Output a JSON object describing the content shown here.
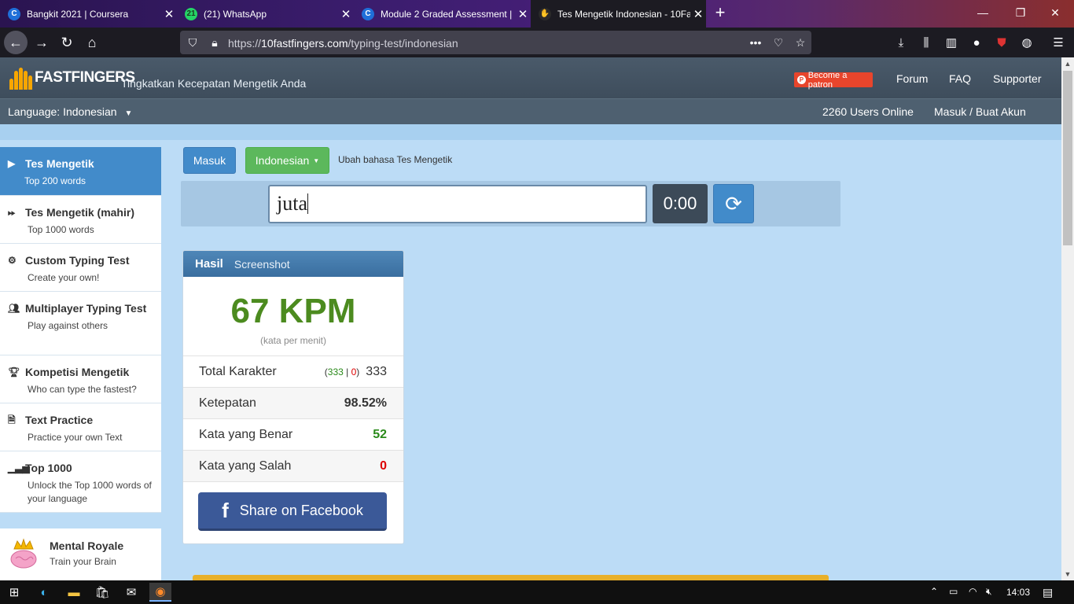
{
  "browser": {
    "tabs": [
      {
        "title": "Bangkit 2021 | Coursera",
        "favicon": "coursera-icon"
      },
      {
        "title": "(21) WhatsApp",
        "favicon": "whatsapp-icon",
        "badge": "21"
      },
      {
        "title": "Module 2 Graded Assessment |",
        "favicon": "coursera-icon"
      },
      {
        "title": "Tes Mengetik Indonesian - 10Fa",
        "favicon": "10fastfingers-icon"
      }
    ],
    "url_scheme": "https://",
    "url_host": "10fastfingers.com",
    "url_path": "/typing-test/indonesian"
  },
  "header": {
    "logo_text": "FASTFINGERS",
    "logo_prefix": "10",
    "tagline": "Tingkatkan Kecepatan Mengetik Anda",
    "patron_label": "Become a patron",
    "nav": [
      "Forum",
      "FAQ",
      "Supporter"
    ]
  },
  "subheader": {
    "language": "Language: Indonesian",
    "users_online": "2260 Users Online",
    "login": "Masuk / Buat Akun"
  },
  "sidebar": {
    "items": [
      {
        "title": "Tes Mengetik",
        "sub": "Top 200 words",
        "icon": "play-icon"
      },
      {
        "title": "Tes Mengetik (mahir)",
        "sub": "Top 1000 words",
        "icon": "fast-forward-icon"
      },
      {
        "title": "Custom Typing Test",
        "sub": "Create your own!",
        "icon": "gears-icon"
      },
      {
        "title": "Multiplayer Typing Test",
        "sub": "Play against others",
        "icon": "users-icon"
      },
      {
        "title": "Kompetisi Mengetik",
        "sub": "Who can type the fastest?",
        "icon": "trophy-icon"
      },
      {
        "title": "Text Practice",
        "sub": "Practice your own Text",
        "icon": "document-icon"
      },
      {
        "title": "Top 1000",
        "sub": "Unlock the Top 1000 words of your language",
        "icon": "signal-icon"
      }
    ],
    "promo": {
      "title": "Mental Royale",
      "sub": "Train your Brain"
    }
  },
  "main": {
    "login_button": "Masuk",
    "language_button": "Indonesian",
    "change_language": "Ubah bahasa Tes Mengetik",
    "input_value": "juta",
    "timer": "0:00"
  },
  "result": {
    "tab_result": "Hasil",
    "tab_screenshot": "Screenshot",
    "wpm": "67 KPM",
    "wpm_sub": "(kata per menit)",
    "rows": [
      {
        "label": "Total Karakter",
        "correct": "333",
        "wrong": "0",
        "value": "333"
      },
      {
        "label": "Ketepatan",
        "value": "98.52%"
      },
      {
        "label": "Kata yang Benar",
        "value": "52"
      },
      {
        "label": "Kata yang Salah",
        "value": "0"
      }
    ],
    "share": "Share on Facebook"
  },
  "taskbar": {
    "clock": "14:03"
  },
  "colors": {
    "accent_blue": "#428bca",
    "green": "#5cb85c",
    "wpm_green": "#4c8b1f",
    "facebook": "#3b5998"
  }
}
